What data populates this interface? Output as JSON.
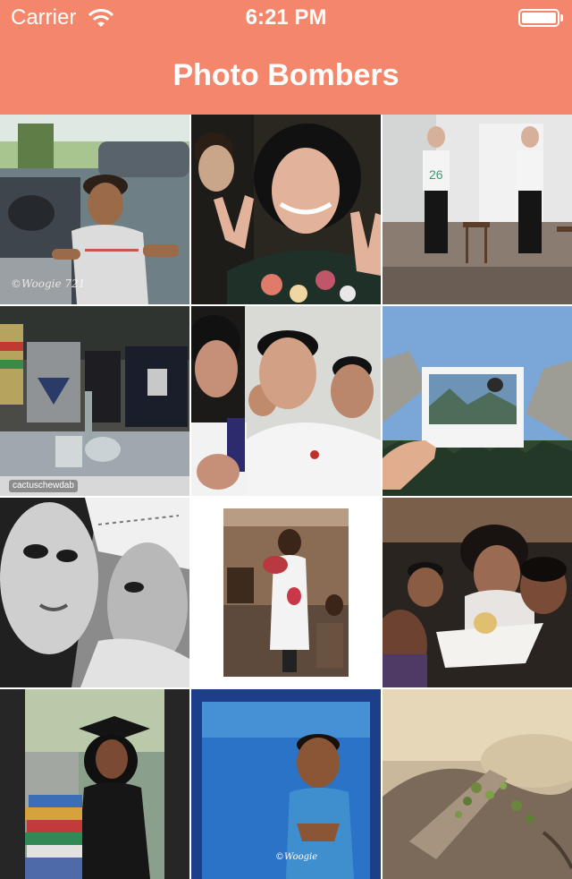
{
  "status_bar": {
    "carrier": "Carrier",
    "time": "6:21 PM"
  },
  "nav": {
    "title": "Photo Bombers",
    "background": "#f4876b"
  },
  "photos": [
    {
      "subject": "boy-in-car",
      "watermark": "©Woogie 721"
    },
    {
      "subject": "peace-sign-selfie"
    },
    {
      "subject": "two-girls-posing"
    },
    {
      "subject": "shop-interior",
      "caption": "cactuschewdab"
    },
    {
      "subject": "group-selfie"
    },
    {
      "subject": "polaroid-mountains"
    },
    {
      "subject": "black-and-white-selfie"
    },
    {
      "subject": "graduate-with-flowers"
    },
    {
      "subject": "family-with-cake"
    },
    {
      "subject": "graduate-with-books"
    },
    {
      "subject": "child-on-blue"
    },
    {
      "subject": "plant-closeup"
    }
  ]
}
